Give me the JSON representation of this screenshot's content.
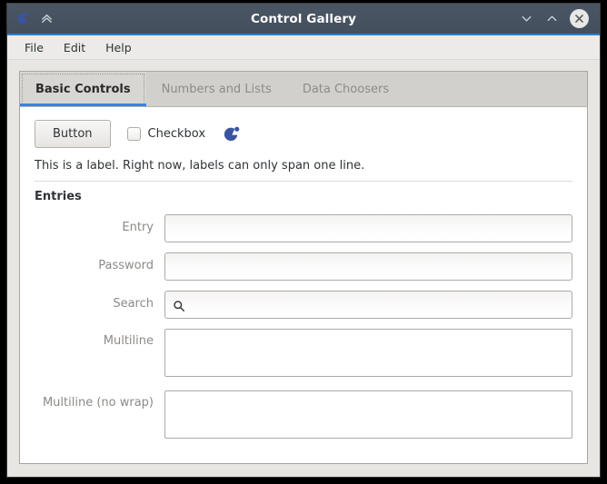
{
  "window": {
    "title": "Control Gallery",
    "app_icon": "app-logo-icon",
    "controls": {
      "minimize": "minimize-icon",
      "maximize": "maximize-icon",
      "close": "close-icon"
    }
  },
  "menubar": {
    "items": [
      {
        "label": "File"
      },
      {
        "label": "Edit"
      },
      {
        "label": "Help"
      }
    ]
  },
  "tabs": [
    {
      "label": "Basic Controls",
      "active": true
    },
    {
      "label": "Numbers and Lists",
      "active": false
    },
    {
      "label": "Data Choosers",
      "active": false
    }
  ],
  "basic_controls": {
    "button_label": "Button",
    "checkbox_label": "Checkbox",
    "checkbox_checked": false,
    "spinner_icon": "spinner-icon",
    "label_text": "This is a label. Right now, labels can only span one line."
  },
  "entries": {
    "group_title": "Entries",
    "fields": [
      {
        "label": "Entry",
        "value": "",
        "placeholder": "",
        "type": "text"
      },
      {
        "label": "Password",
        "value": "",
        "placeholder": "",
        "type": "password"
      },
      {
        "label": "Search",
        "value": "",
        "placeholder": "",
        "type": "search"
      },
      {
        "label": "Multiline",
        "value": "",
        "placeholder": "",
        "type": "textarea"
      },
      {
        "label": "Multiline (no wrap)",
        "value": "",
        "placeholder": "",
        "type": "textarea-nowrap"
      }
    ]
  },
  "colors": {
    "titlebar": "#454f5d",
    "titlebar_accent": "#2e7ec4",
    "tab_active_underline": "#3584e4",
    "brand_blue": "#3a54a0",
    "window_bg": "#e8e6e3",
    "tabstrip_bg": "#d2d0cd",
    "page_bg": "#ffffff"
  }
}
